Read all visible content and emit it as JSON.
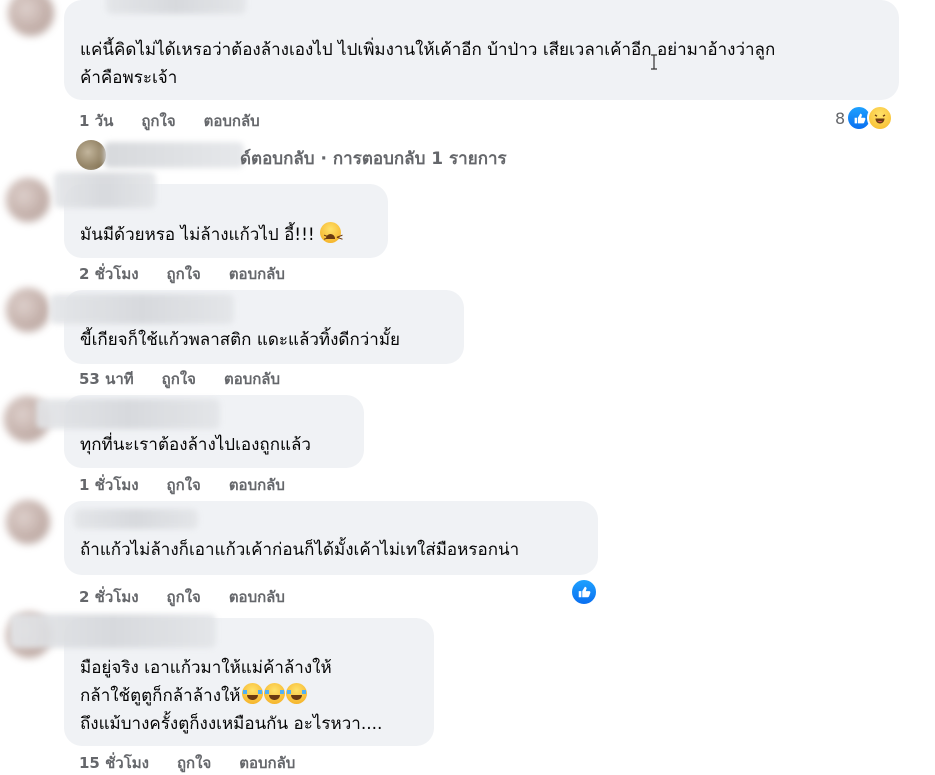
{
  "comments": [
    {
      "lines": [
        "แค่นี้คิดไม่ได้เหรอว่าต้องล้างเองไป ไปเพิ่มงานให้เค้าอีก บ้าป่าว เสียเวลาเค้าอีก อย่ามาอ้างว่าลูก",
        "ค้าคือพระเจ้า"
      ],
      "time": "1 วัน",
      "like": "ถูกใจ",
      "reply": "ตอบกลับ",
      "reaction_count": "8",
      "reactions": [
        "like-icon",
        "haha-icon"
      ]
    },
    {
      "lines": [
        "มันมีด้วยหรอ ไม่ล้างแก้วไป อี้!!! "
      ],
      "emoji": "tired-face-icon",
      "time": "2 ชั่วโมง",
      "like": "ถูกใจ",
      "reply": "ตอบกลับ"
    },
    {
      "lines": [
        "ขี้เกียจก็ใช้แก้วพลาสติก แดะแล้วทิ้งดีกว่ามั้ย"
      ],
      "time": "53 นาที",
      "like": "ถูกใจ",
      "reply": "ตอบกลับ"
    },
    {
      "lines": [
        "ทุกที่นะเราต้องล้างไปเองถูกแล้ว"
      ],
      "time": "1 ชั่วโมง",
      "like": "ถูกใจ",
      "reply": "ตอบกลับ"
    },
    {
      "lines": [
        "ถ้าแก้วไม่ล้างก็เอาแก้วเค้าก่อนก็ได้มั้งเค้าไม่เทใส่มือหรอกน่า"
      ],
      "time": "2 ชั่วโมง",
      "like": "ถูกใจ",
      "reply": "ตอบกลับ",
      "reactions": [
        "like-icon"
      ]
    },
    {
      "lines": [
        "มือยู่จริง เอาแก้วมาให้แม่ค้าล้างให้",
        "กล้าใช้ตูตูก็กล้าล้างให้",
        "ถึงแม้บางครั้งตูก็งงเหมือนกัน อะไรหวา...."
      ],
      "emoji": "crying-laughing-icon",
      "time": "15 ชั่วโมง",
      "like": "ถูกใจ",
      "reply": "ตอบกลับ"
    }
  ],
  "replies_link": {
    "text": "ด์ตอบกลับ · การตอบกลับ 1 รายการ"
  },
  "colors": {
    "bubble": "#f0f2f5",
    "meta": "#65676b",
    "text": "#050505",
    "like_blue": "#1877f2"
  }
}
